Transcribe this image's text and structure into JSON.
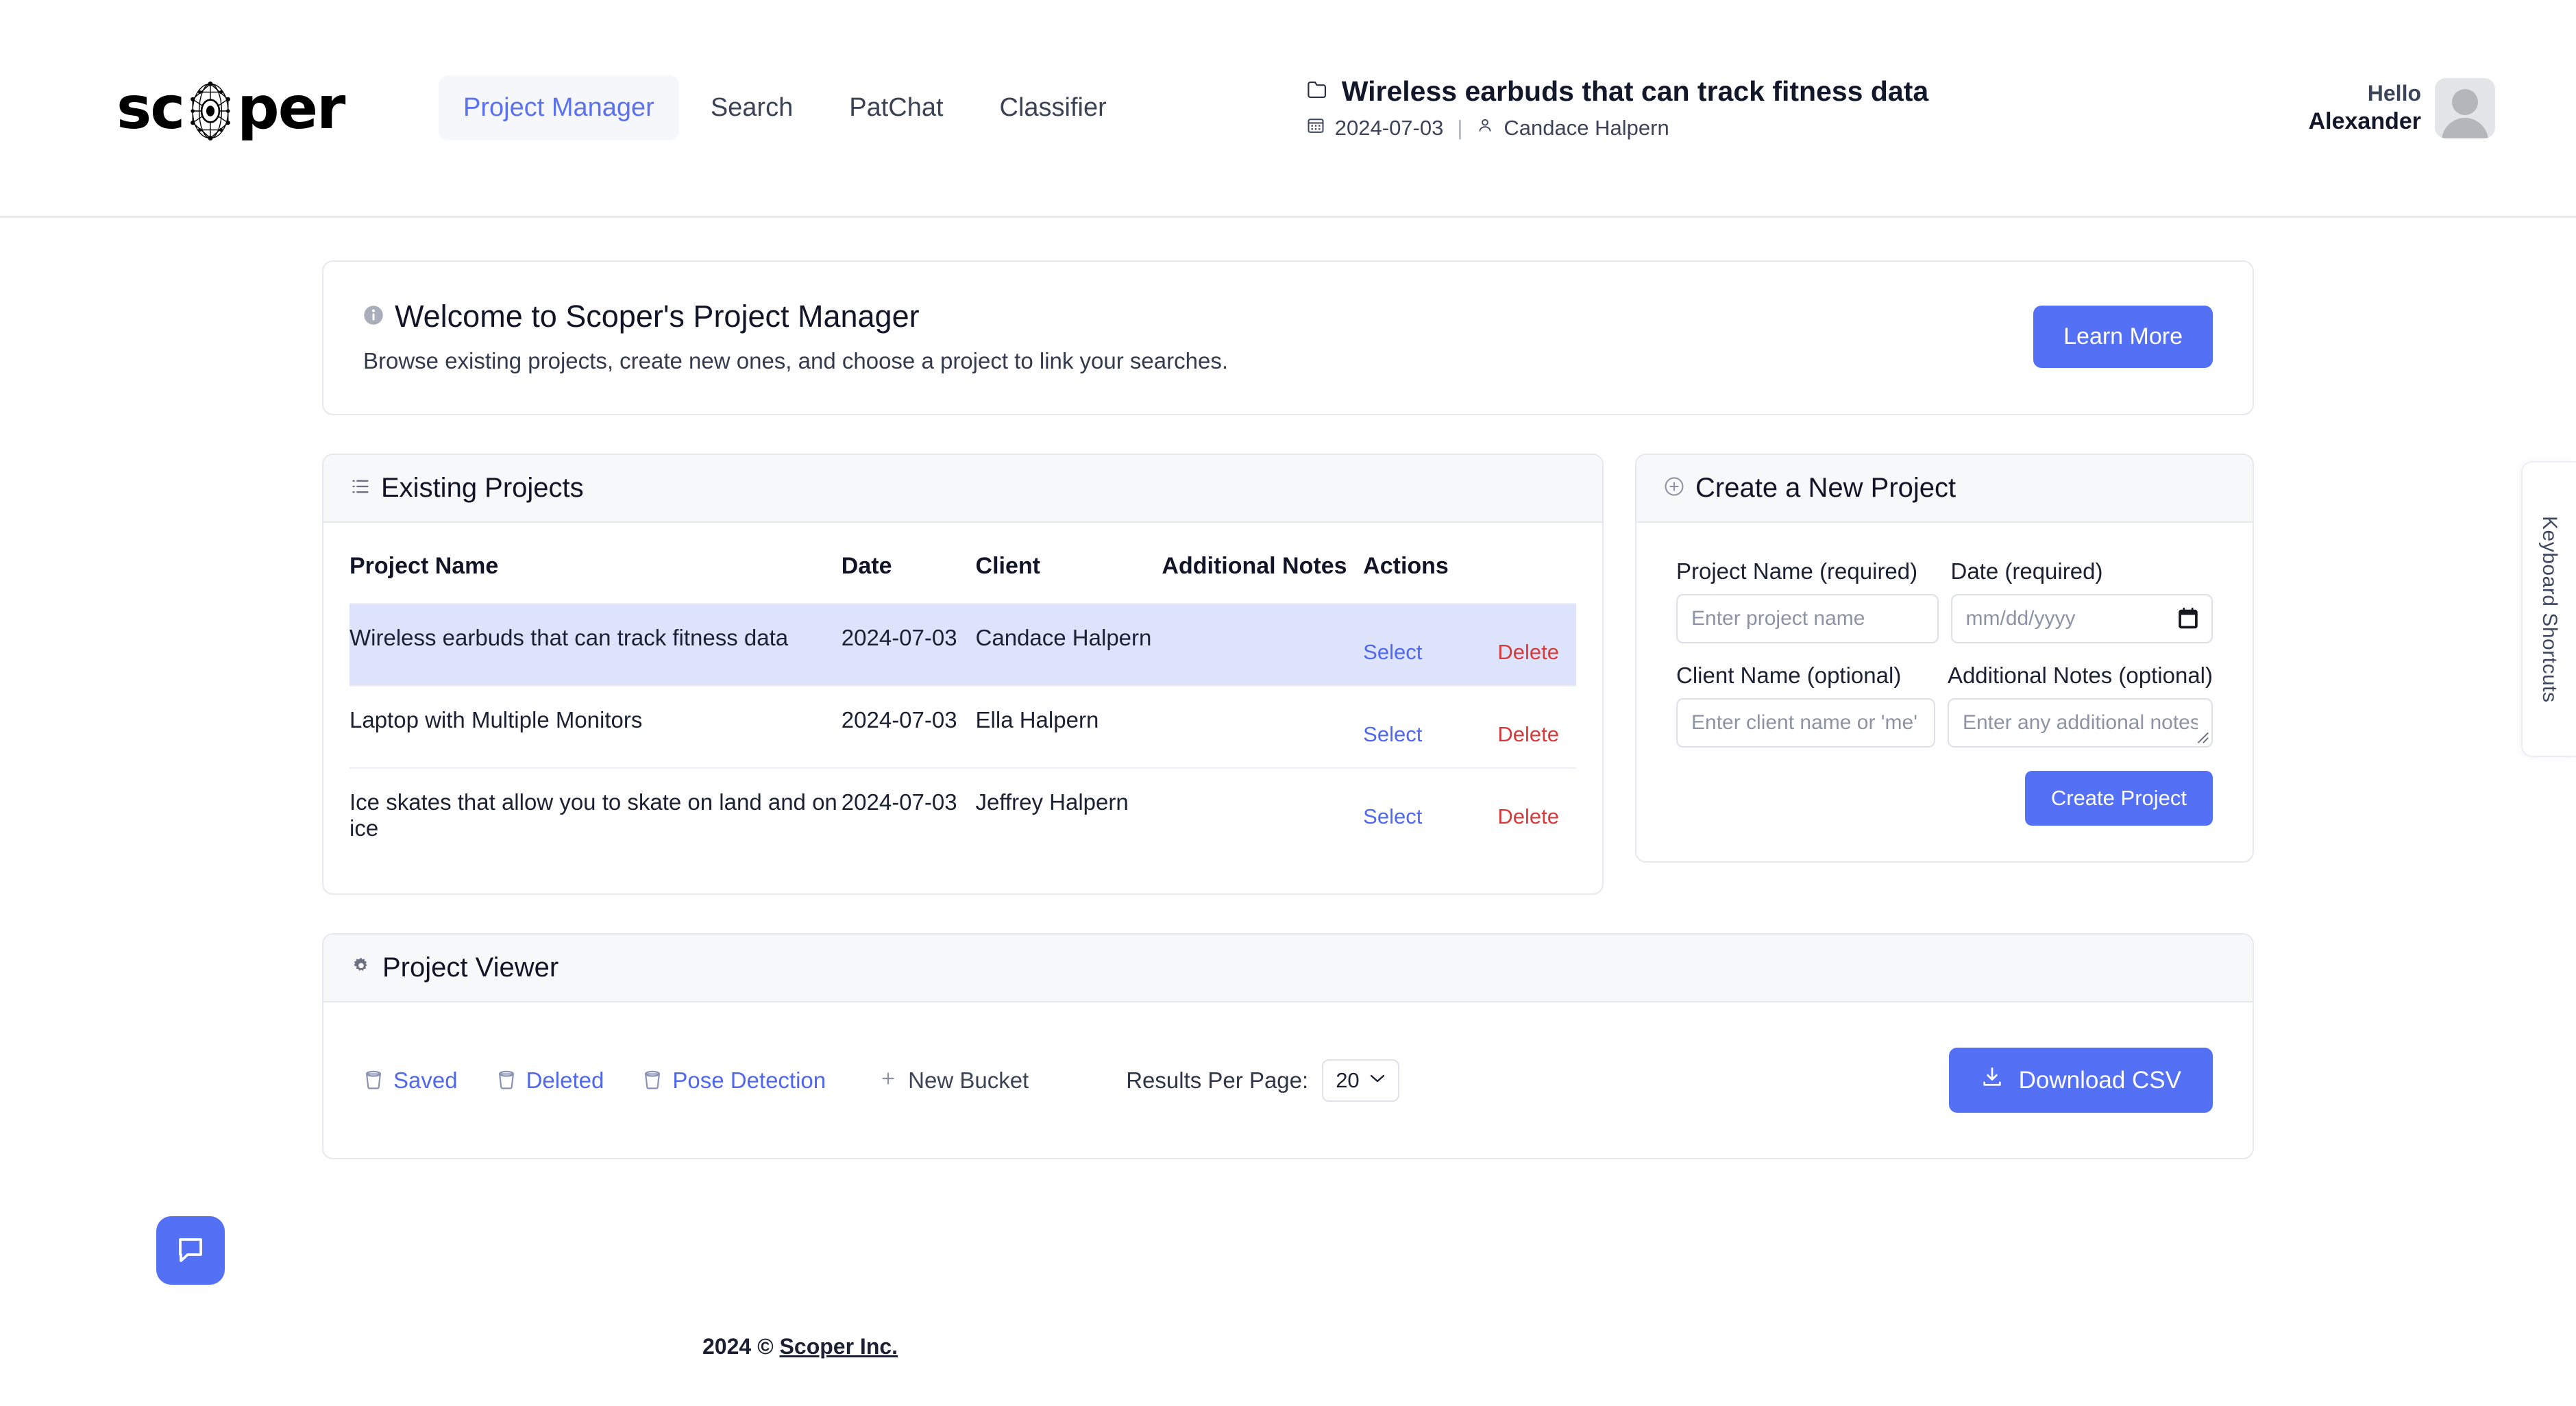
{
  "brand": {
    "logo_text_before": "sc",
    "logo_text_after": "per",
    "logo_icon": "network-eye-icon"
  },
  "nav": {
    "items": [
      {
        "label": "Project Manager",
        "active": true
      },
      {
        "label": "Search",
        "active": false
      },
      {
        "label": "PatChat",
        "active": false
      },
      {
        "label": "Classifier",
        "active": false
      }
    ]
  },
  "project_header": {
    "folder_icon": "folder-icon",
    "title": "Wireless earbuds that can track fitness data",
    "calendar_icon": "calendar-icon",
    "date": "2024-07-03",
    "separator": "|",
    "person_icon": "person-icon",
    "client": "Candace Halpern"
  },
  "user": {
    "greeting": "Hello",
    "name": "Alexander",
    "avatar_icon": "avatar-placeholder-icon"
  },
  "welcome": {
    "info_icon": "info-circle-icon",
    "title": "Welcome to Scoper's Project Manager",
    "subtitle": "Browse existing projects, create new ones, and choose a project to link your searches.",
    "learn_more_label": "Learn More"
  },
  "existing_projects": {
    "list_icon": "list-icon",
    "title": "Existing Projects",
    "columns": [
      "Project Name",
      "Date",
      "Client",
      "Additional Notes",
      "Actions"
    ],
    "rows": [
      {
        "name": "Wireless earbuds that can track fitness data",
        "date": "2024-07-03",
        "client": "Candace Halpern",
        "notes": "",
        "select_label": "Select",
        "delete_label": "Delete",
        "selected": true
      },
      {
        "name": "Laptop with Multiple Monitors",
        "date": "2024-07-03",
        "client": "Ella Halpern",
        "notes": "",
        "select_label": "Select",
        "delete_label": "Delete",
        "selected": false
      },
      {
        "name": "Ice skates that allow you to skate on land and on ice",
        "date": "2024-07-03",
        "client": "Jeffrey Halpern",
        "notes": "",
        "select_label": "Select",
        "delete_label": "Delete",
        "selected": false
      }
    ]
  },
  "create_project": {
    "plus_icon": "plus-circle-icon",
    "title": "Create a New Project",
    "fields": {
      "project_name_label": "Project Name (required)",
      "project_name_placeholder": "Enter project name",
      "project_name_value": "",
      "date_label": "Date (required)",
      "date_placeholder": "mm/dd/yyyy",
      "date_value": "",
      "date_picker_icon": "calendar-picker-icon",
      "client_name_label": "Client Name (optional)",
      "client_name_placeholder": "Enter client name or 'me'",
      "client_name_value": "",
      "notes_label": "Additional Notes (optional)",
      "notes_placeholder": "Enter any additional notes",
      "notes_value": ""
    },
    "submit_label": "Create Project"
  },
  "project_viewer": {
    "gear_icon": "gear-icon",
    "title": "Project Viewer",
    "buckets": [
      {
        "label": "Saved",
        "icon": "bucket-icon"
      },
      {
        "label": "Deleted",
        "icon": "bucket-icon"
      },
      {
        "label": "Pose Detection",
        "icon": "bucket-icon"
      }
    ],
    "new_bucket_label": "New Bucket",
    "new_bucket_icon": "plus-icon",
    "results_per_page_label": "Results Per Page:",
    "results_per_page_value": "20",
    "results_per_page_options": [
      "20"
    ],
    "chevron_icon": "chevron-down-icon",
    "download_label": "Download CSV",
    "download_icon": "download-icon"
  },
  "footer": {
    "year_copy": "2024 ©",
    "company": "Scoper Inc."
  },
  "chat": {
    "icon": "chat-bubble-icon"
  },
  "keyboard_shortcuts": {
    "label": "Keyboard Shortcuts"
  },
  "colors": {
    "accent_blue": "#5470f5",
    "link_blue": "#4f68ef",
    "delete_red": "#d63a3a",
    "selected_row": "#dde3fa",
    "card_header_bg": "#f7f8fa",
    "border": "#e6e8ee"
  }
}
